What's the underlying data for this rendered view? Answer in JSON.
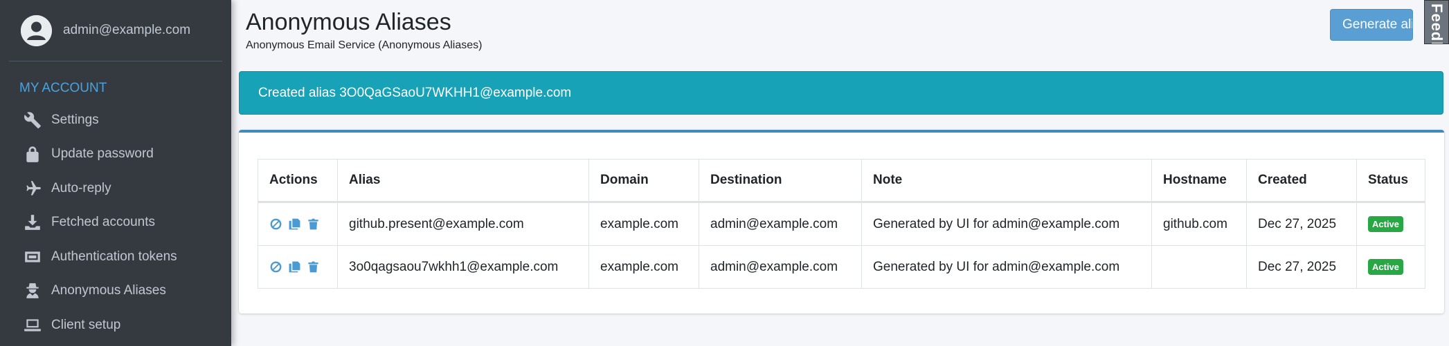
{
  "sidebar": {
    "user_email": "admin@example.com",
    "section_header": "MY ACCOUNT",
    "items": [
      {
        "label": "Settings",
        "icon": "wrench-icon"
      },
      {
        "label": "Update password",
        "icon": "lock-icon"
      },
      {
        "label": "Auto-reply",
        "icon": "plane-icon"
      },
      {
        "label": "Fetched accounts",
        "icon": "download-icon"
      },
      {
        "label": "Authentication tokens",
        "icon": "id-card-icon"
      },
      {
        "label": "Anonymous Aliases",
        "icon": "user-secret-icon"
      },
      {
        "label": "Client setup",
        "icon": "laptop-icon"
      }
    ]
  },
  "header": {
    "title": "Anonymous Aliases",
    "subtitle": "Anonymous Email Service (Anonymous Aliases)",
    "generate_button": "Generate alias",
    "feedback_label": "Feedback"
  },
  "alert": {
    "message": "Created alias 3O0QaGSaoU7WKHH1@example.com",
    "color": "#17a2b8"
  },
  "table": {
    "columns": [
      "Actions",
      "Alias",
      "Domain",
      "Destination",
      "Note",
      "Hostname",
      "Created",
      "Status"
    ],
    "rows": [
      {
        "alias": "github.present@example.com",
        "domain": "example.com",
        "destination": "admin@example.com",
        "note": "Generated by UI for admin@example.com",
        "hostname": "github.com",
        "created": "Dec 27, 2025",
        "status": "Active"
      },
      {
        "alias": "3o0qagsaou7wkhh1@example.com",
        "domain": "example.com",
        "destination": "admin@example.com",
        "note": "Generated by UI for admin@example.com",
        "hostname": "",
        "created": "Dec 27, 2025",
        "status": "Active"
      }
    ]
  },
  "colors": {
    "sidebar_bg": "#343a40",
    "accent": "#3c8dbc",
    "status_active": "#28a745",
    "action_icons": "#4a9ad4"
  }
}
